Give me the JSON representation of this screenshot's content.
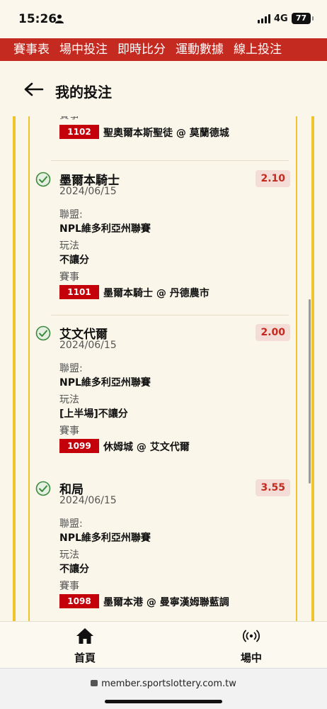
{
  "status": {
    "time": "15:26",
    "network": "4G",
    "battery": "77"
  },
  "topnav": [
    "賽事表",
    "場中投注",
    "即時比分",
    "運動數據",
    "線上投注"
  ],
  "header": {
    "title": "我的投注"
  },
  "partial": {
    "label": "賽事",
    "code": "1102",
    "match": "聖奧爾本斯聖徒 @ 莫蘭德城"
  },
  "bets": [
    {
      "pick": "墨爾本騎士",
      "date": "2024/06/15",
      "odds": "2.10",
      "league_label": "聯盟:",
      "league": "NPL維多利亞州聯賽",
      "market_label": "玩法",
      "market": "不讓分",
      "event_label": "賽事",
      "code": "1101",
      "match": "墨爾本騎士 @ 丹德農市"
    },
    {
      "pick": "艾文代爾",
      "date": "2024/06/15",
      "odds": "2.00",
      "league_label": "聯盟:",
      "league": "NPL維多利亞州聯賽",
      "market_label": "玩法",
      "market": "[上半場]不讓分",
      "event_label": "賽事",
      "code": "1099",
      "match": "休姆城 @ 艾文代爾"
    },
    {
      "pick": "和局",
      "date": "2024/06/15",
      "odds": "3.55",
      "league_label": "聯盟:",
      "league": "NPL維多利亞州聯賽",
      "market_label": "玩法",
      "market": "不讓分",
      "event_label": "賽事",
      "code": "1098",
      "match": "墨爾本港 @ 曼寧漢姆聯藍調"
    }
  ],
  "bottomnav": {
    "home": "首頁",
    "live": "場中"
  },
  "browser": {
    "url": "member.sportslottery.com.tw"
  },
  "colors": {
    "brand_red": "#c42a1f",
    "rail_yellow": "#f0c42c",
    "odds_bg": "#f3ddd6",
    "check_green": "#3a8a3a"
  }
}
